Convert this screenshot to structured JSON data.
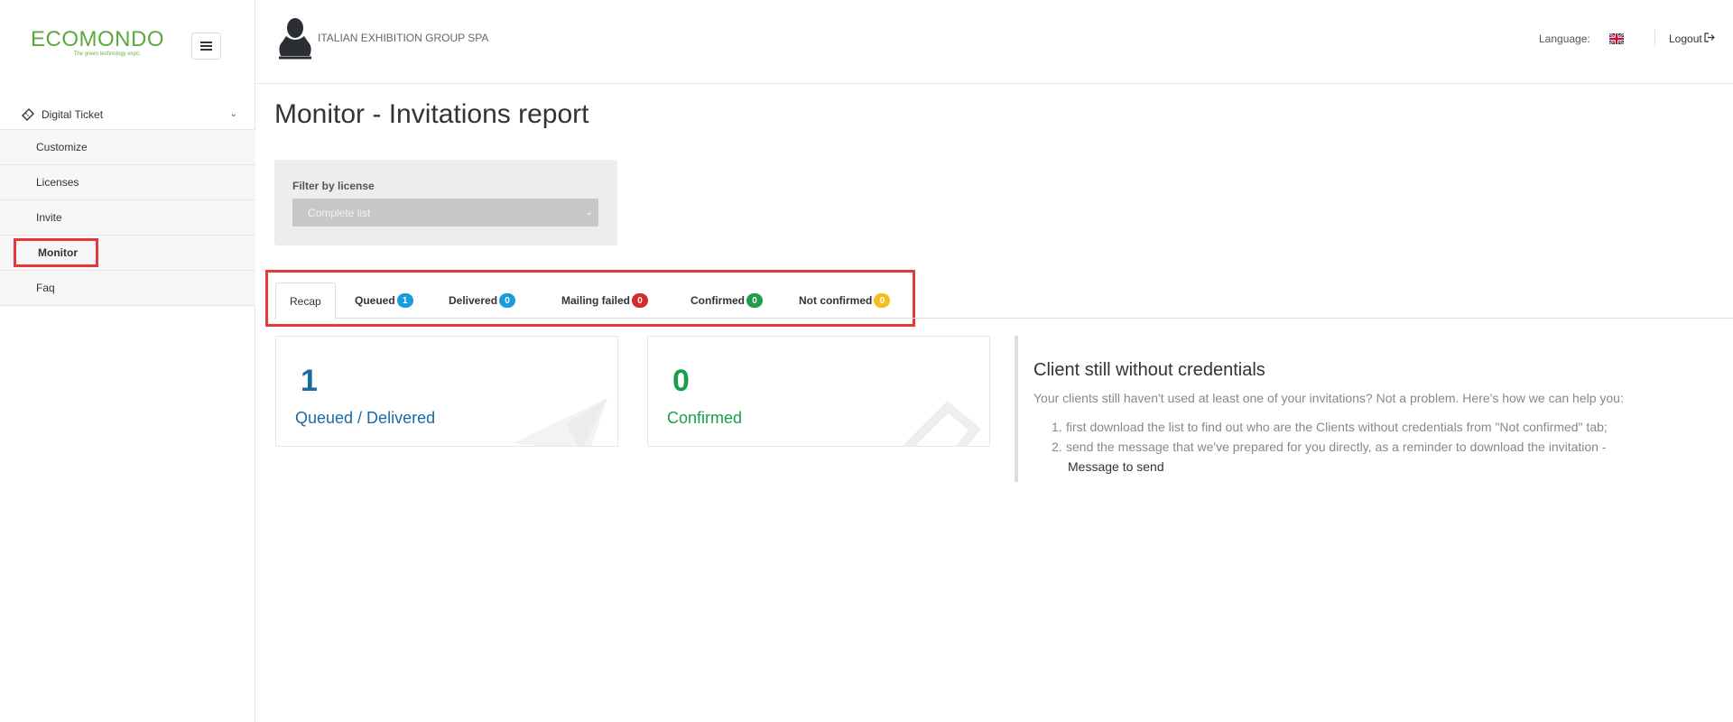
{
  "brand": {
    "name": "ECOMONDO",
    "tagline": "The green technology expo."
  },
  "sidebar": {
    "menu_button_label": "",
    "group": {
      "label": "Digital Ticket",
      "icon": "ticket-icon"
    },
    "items": [
      {
        "label": "Customize"
      },
      {
        "label": "Licenses"
      },
      {
        "label": "Invite"
      },
      {
        "label": "Monitor",
        "active": true
      },
      {
        "label": "Faq"
      }
    ]
  },
  "topbar": {
    "company": "ITALIAN EXHIBITION GROUP SPA",
    "language_label": "Language:",
    "language_flag": "uk-flag-icon",
    "logout_label": "Logout"
  },
  "page": {
    "title": "Monitor - Invitations report"
  },
  "filter": {
    "label": "Filter by license",
    "selected": "Complete list"
  },
  "tabs": [
    {
      "label": "Recap",
      "active": true
    },
    {
      "label": "Queued",
      "badge": "1",
      "color": "#1a9bdb"
    },
    {
      "label": "Delivered",
      "badge": "0",
      "color": "#1a9bdb"
    },
    {
      "label": "Mailing failed",
      "badge": "0",
      "color": "#d52b2b"
    },
    {
      "label": "Confirmed",
      "badge": "0",
      "color": "#1e9e4b"
    },
    {
      "label": "Not confirmed",
      "badge": "0",
      "color": "#f2c01e"
    }
  ],
  "cards": [
    {
      "value": "1",
      "label": "Queued / Delivered",
      "color": "#1a6aa6",
      "icon": "paper-plane-icon"
    },
    {
      "value": "0",
      "label": "Confirmed",
      "color": "#1a9e4b",
      "icon": "ticket-icon"
    }
  ],
  "info": {
    "title": "Client still without credentials",
    "text": "Your clients still haven't used at least one of your invitations? Not a problem. Here's how we can help you:",
    "steps": [
      {
        "num": "1.",
        "text": "first download the list to find out who are the Clients without credentials from \"Not confirmed\" tab;"
      },
      {
        "num": "2.",
        "text": "send the message that we've prepared for you directly, as a reminder to download the invitation -",
        "link": "Message to send"
      }
    ]
  }
}
